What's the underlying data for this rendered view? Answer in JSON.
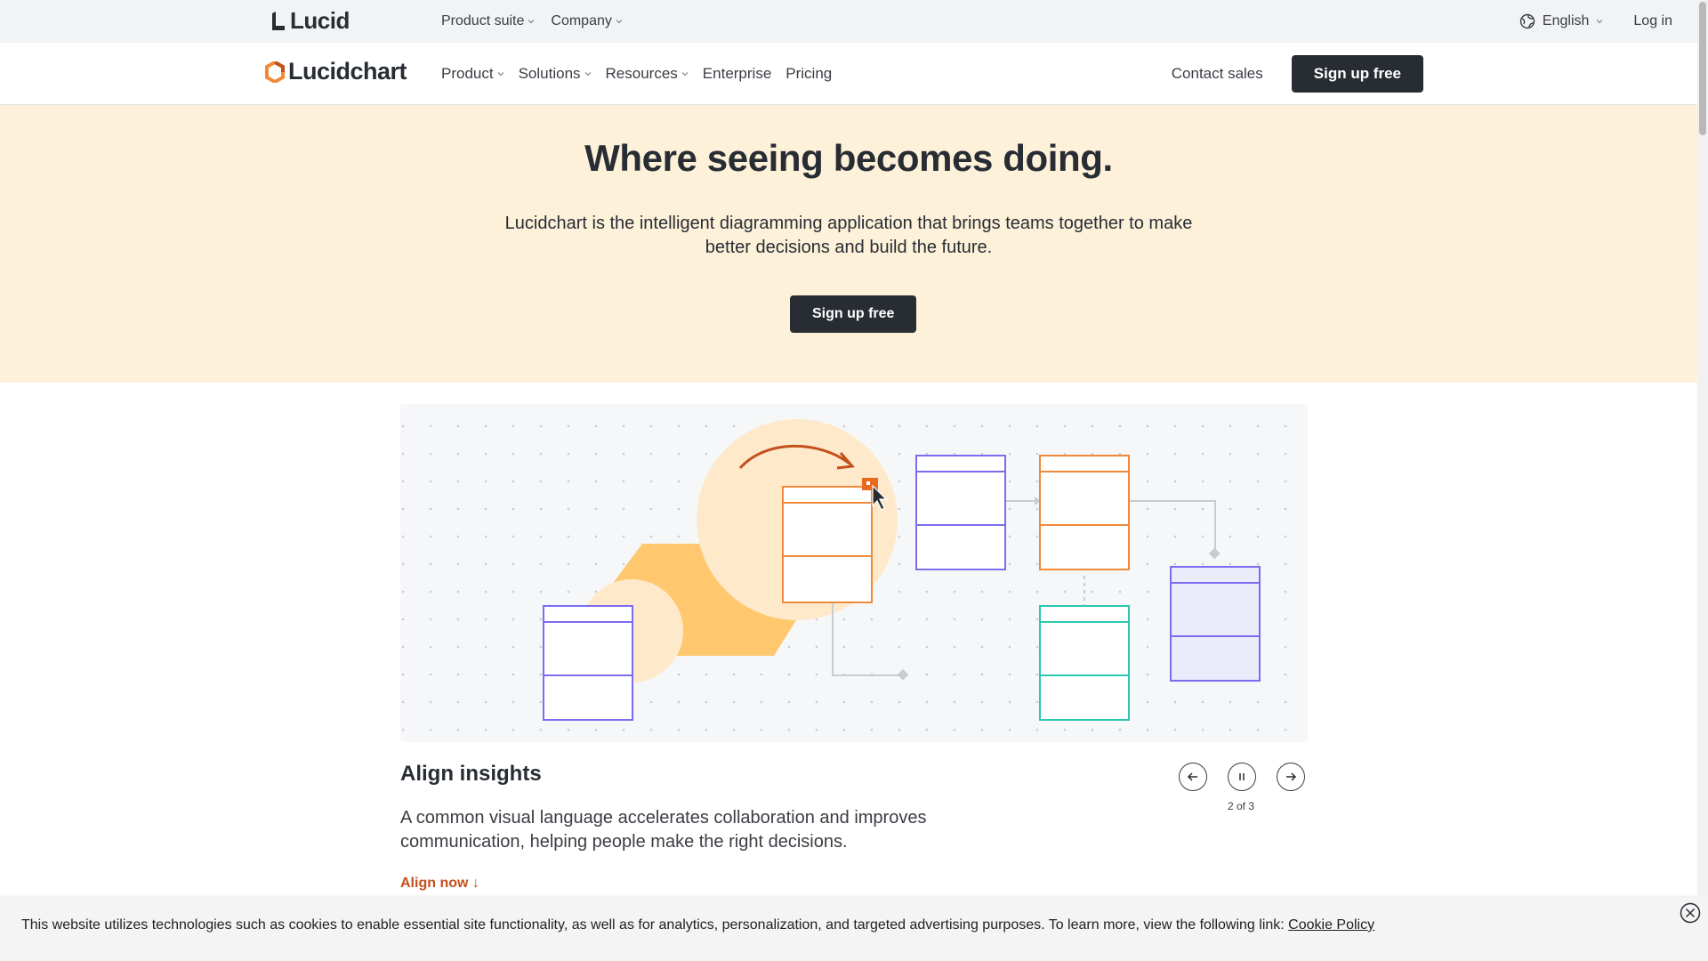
{
  "topbar": {
    "logo_text": "Lucid",
    "nav": [
      {
        "label": "Product suite"
      },
      {
        "label": "Company"
      }
    ],
    "language": "English",
    "login": "Log in"
  },
  "header": {
    "logo_text": "Lucidchart",
    "nav": [
      {
        "label": "Product"
      },
      {
        "label": "Solutions"
      },
      {
        "label": "Resources"
      },
      {
        "label": "Enterprise"
      },
      {
        "label": "Pricing"
      }
    ],
    "contact_sales": "Contact sales",
    "signup": "Sign up free"
  },
  "hero": {
    "title": "Where seeing becomes doing.",
    "subtitle": "Lucidchart is the intelligent diagramming application that brings teams together to make better decisions and build the future.",
    "cta": "Sign up free"
  },
  "slide": {
    "title": "Align insights",
    "description": "A common visual language accelerates collaboration and improves communication, helping people make the right decisions.",
    "link": "Align now ↓",
    "counter": "2 of 3"
  },
  "cookie": {
    "message": "This website utilizes technologies such as cookies to enable essential site functionality, as well as for analytics, personalization, and targeted advertising purposes. To learn more, view the following link: ",
    "link": "Cookie Policy"
  },
  "colors": {
    "accent": "#c4501b",
    "hero_bg": "#fdf1d9",
    "dark": "#282c33",
    "purple": "#7b6cf0",
    "orange": "#f08a3a",
    "teal": "#2cc7b0",
    "yellow": "#ffc86e"
  }
}
